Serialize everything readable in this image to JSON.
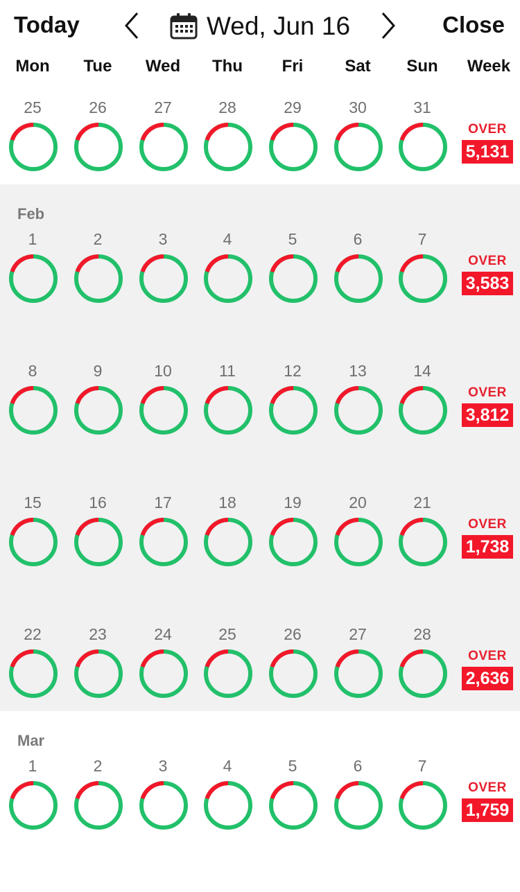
{
  "header": {
    "today_label": "Today",
    "close_label": "Close",
    "date_label": "Wed, Jun 16",
    "icons": {
      "prev": "chevron-left-icon",
      "next": "chevron-right-icon",
      "calendar": "calendar-icon"
    }
  },
  "weekdays": [
    "Mon",
    "Tue",
    "Wed",
    "Thu",
    "Fri",
    "Sat",
    "Sun"
  ],
  "week_label": "Week",
  "colors": {
    "ring_green": "#22c06a",
    "ring_red": "#f3172a",
    "row_gray": "#f1f1f1"
  },
  "weeks": [
    {
      "month": "",
      "bg": "white",
      "days": [
        "25",
        "26",
        "27",
        "28",
        "29",
        "30",
        "31"
      ],
      "status": "OVER",
      "value": "5,131"
    },
    {
      "month": "Feb",
      "bg": "gray",
      "days": [
        "1",
        "2",
        "3",
        "4",
        "5",
        "6",
        "7"
      ],
      "status": "OVER",
      "value": "3,583"
    },
    {
      "month": "",
      "bg": "gray",
      "days": [
        "8",
        "9",
        "10",
        "11",
        "12",
        "13",
        "14"
      ],
      "status": "OVER",
      "value": "3,812"
    },
    {
      "month": "",
      "bg": "gray",
      "days": [
        "15",
        "16",
        "17",
        "18",
        "19",
        "20",
        "21"
      ],
      "status": "OVER",
      "value": "1,738"
    },
    {
      "month": "",
      "bg": "gray",
      "days": [
        "22",
        "23",
        "24",
        "25",
        "26",
        "27",
        "28"
      ],
      "status": "OVER",
      "value": "2,636"
    },
    {
      "month": "Mar",
      "bg": "white",
      "days": [
        "1",
        "2",
        "3",
        "4",
        "5",
        "6",
        "7"
      ],
      "status": "OVER",
      "value": "1,759"
    }
  ],
  "ring_over_fraction": 0.2
}
